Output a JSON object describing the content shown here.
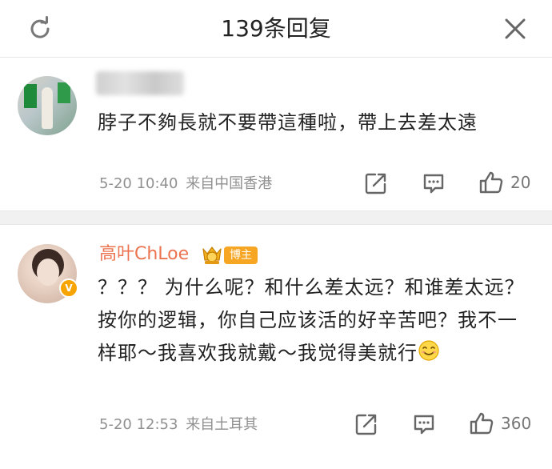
{
  "header": {
    "title": "139条回复"
  },
  "comments": [
    {
      "username": "",
      "username_blurred": true,
      "content": "脖子不夠長就不要帶這種啦，帶上去差太遠",
      "date": "5-20 10:40",
      "location": "来自中国香港",
      "likes": "20"
    },
    {
      "username": "高叶ChLoe",
      "badge": "博主",
      "verified": "V",
      "content": "？？？ 为什么呢？和什么差太远？和谁差太远？按你的逻辑，你自己应该活的好辛苦吧？我不一样耶～我喜欢我就戴～我觉得美就行",
      "date": "5-20 12:53",
      "location": "来自土耳其",
      "likes": "360"
    }
  ],
  "colors": {
    "username": "#eb7350",
    "badge": "#f6a623",
    "meta": "#909090",
    "icon": "#666666"
  },
  "icons": [
    "refresh-icon",
    "close-icon",
    "share-icon",
    "comment-icon",
    "like-icon",
    "smile-emoji-icon",
    "medal-icon"
  ]
}
